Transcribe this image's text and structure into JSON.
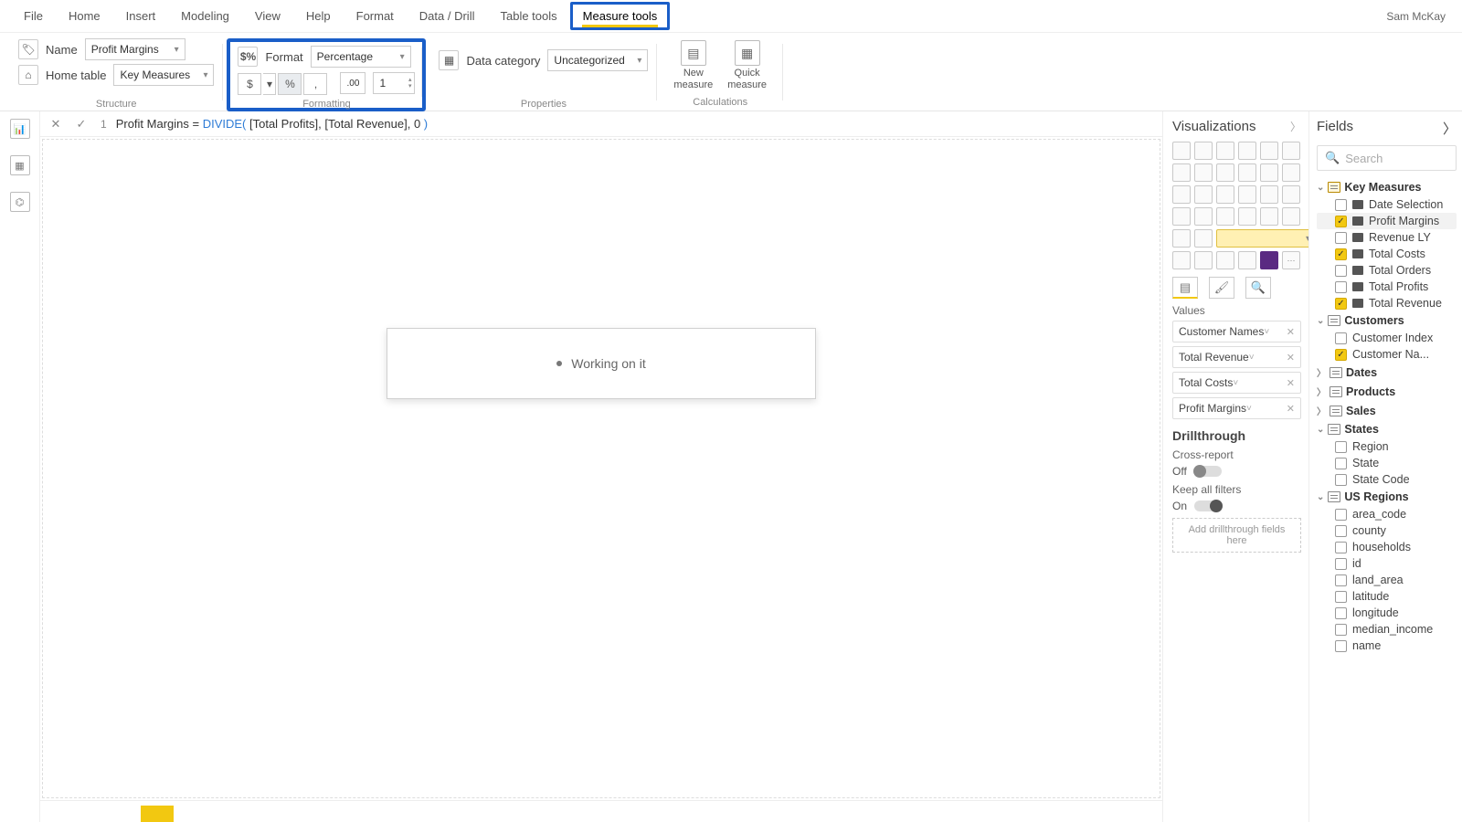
{
  "user": "Sam McKay",
  "menu": [
    "File",
    "Home",
    "Insert",
    "Modeling",
    "View",
    "Help",
    "Format",
    "Data / Drill",
    "Table tools",
    "Measure tools"
  ],
  "menu_active": "Measure tools",
  "structure": {
    "name_label": "Name",
    "name_value": "Profit Margins",
    "home_label": "Home table",
    "home_value": "Key Measures",
    "group": "Structure"
  },
  "formatting": {
    "format_label": "Format",
    "format_value": "Percentage",
    "currency": "$",
    "percent": "%",
    "comma": ",",
    "dec_inc": ".00",
    "decimals": "1",
    "group": "Formatting"
  },
  "properties": {
    "datacat_label": "Data category",
    "datacat_value": "Uncategorized",
    "group": "Properties"
  },
  "calcs": {
    "new_measure": "New\nmeasure",
    "quick_measure": "Quick\nmeasure",
    "group": "Calculations"
  },
  "formula": {
    "line": "1",
    "name": "Profit Margins",
    "eq": " = ",
    "fn": "DIVIDE(",
    "arg1": " [Total Profits]",
    "sep1": ", ",
    "arg2": "[Total Revenue]",
    "sep2": ", ",
    "arg3": "0 ",
    "close": ")"
  },
  "working": "Working on it",
  "viz": {
    "title": "Visualizations",
    "tools_section": "Values",
    "wells": [
      "Customer Names",
      "Total Revenue",
      "Total Costs",
      "Profit Margins"
    ],
    "drill_title": "Drillthrough",
    "cross": "Cross-report",
    "off": "Off",
    "keep": "Keep all filters",
    "on": "On",
    "dt_placeholder": "Add drillthrough fields here"
  },
  "fields": {
    "title": "Fields",
    "search": "Search",
    "tables": [
      {
        "name": "Key Measures",
        "open": true,
        "measure": true,
        "fields": [
          {
            "name": "Date Selection",
            "checked": false,
            "m": true
          },
          {
            "name": "Profit Margins",
            "checked": true,
            "m": true,
            "sel": true
          },
          {
            "name": "Revenue LY",
            "checked": false,
            "m": true
          },
          {
            "name": "Total Costs",
            "checked": true,
            "m": true
          },
          {
            "name": "Total Orders",
            "checked": false,
            "m": true
          },
          {
            "name": "Total Profits",
            "checked": false,
            "m": true
          },
          {
            "name": "Total Revenue",
            "checked": true,
            "m": true
          }
        ]
      },
      {
        "name": "Customers",
        "open": true,
        "fields": [
          {
            "name": "Customer Index",
            "checked": false
          },
          {
            "name": "Customer Na...",
            "checked": true
          }
        ]
      },
      {
        "name": "Dates",
        "open": false
      },
      {
        "name": "Products",
        "open": false
      },
      {
        "name": "Sales",
        "open": false
      },
      {
        "name": "States",
        "open": true,
        "fields": [
          {
            "name": "Region",
            "checked": false
          },
          {
            "name": "State",
            "checked": false
          },
          {
            "name": "State Code",
            "checked": false
          }
        ]
      },
      {
        "name": "US Regions",
        "open": true,
        "fields": [
          {
            "name": "area_code",
            "checked": false
          },
          {
            "name": "county",
            "checked": false
          },
          {
            "name": "households",
            "checked": false
          },
          {
            "name": "id",
            "checked": false
          },
          {
            "name": "land_area",
            "checked": false
          },
          {
            "name": "latitude",
            "checked": false
          },
          {
            "name": "longitude",
            "checked": false
          },
          {
            "name": "median_income",
            "checked": false
          },
          {
            "name": "name",
            "checked": false
          }
        ]
      }
    ]
  }
}
